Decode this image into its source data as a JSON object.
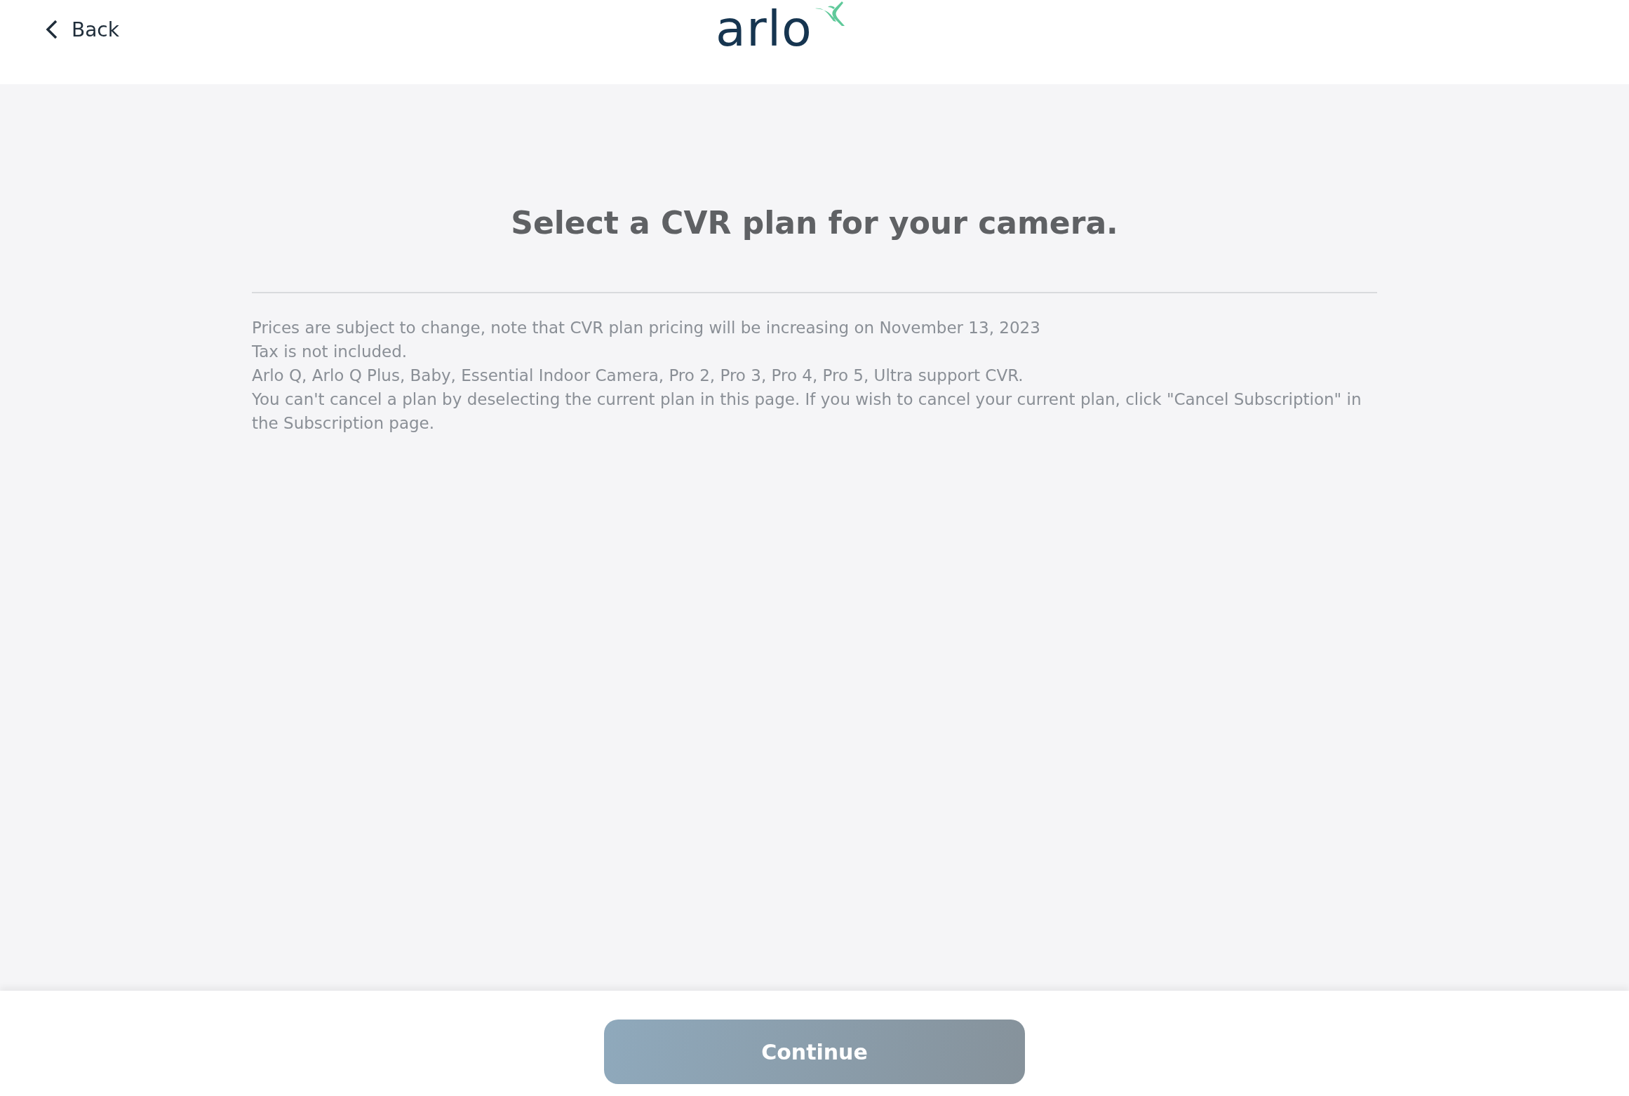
{
  "header": {
    "back": {
      "label": "Back"
    },
    "logo": "arlo"
  },
  "title": "Select a CVR plan for your camera.",
  "notes": [
    "Prices are subject to change, note that CVR plan pricing will be increasing on November 13, 2023",
    "Tax is not included.",
    "Arlo Q, Arlo Q Plus, Baby, Essential Indoor Camera, Pro 2, Pro 3, Pro 4, Pro 5, Ultra support CVR.",
    "You can't cancel a plan by deselecting the current plan in this page. If you wish to cancel your current plan, click \"Cancel Subscription\" in the Subscription page."
  ],
  "footer": {
    "button": {
      "label": "Continue",
      "disabled": true
    }
  }
}
